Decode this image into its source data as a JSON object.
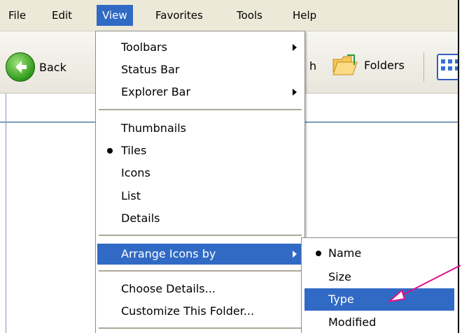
{
  "menubar": {
    "items": [
      "File",
      "Edit",
      "View",
      "Favorites",
      "Tools",
      "Help"
    ],
    "active": "View"
  },
  "toolbar": {
    "back_label": "Back",
    "partial_label": "h",
    "folders_label": "Folders"
  },
  "view_menu": {
    "toolbars": "Toolbars",
    "status_bar": "Status Bar",
    "explorer_bar": "Explorer Bar",
    "thumbnails": "Thumbnails",
    "tiles": "Tiles",
    "icons": "Icons",
    "list": "List",
    "details": "Details",
    "arrange_icons_by": "Arrange Icons by",
    "choose_details": "Choose Details...",
    "customize_folder": "Customize This Folder..."
  },
  "arrange_submenu": {
    "name": "Name",
    "size": "Size",
    "type": "Type",
    "modified": "Modified"
  },
  "colors": {
    "highlight": "#316ac5",
    "menubar_bg": "#ece9d8",
    "annotation_arrow": "#e0108a"
  }
}
